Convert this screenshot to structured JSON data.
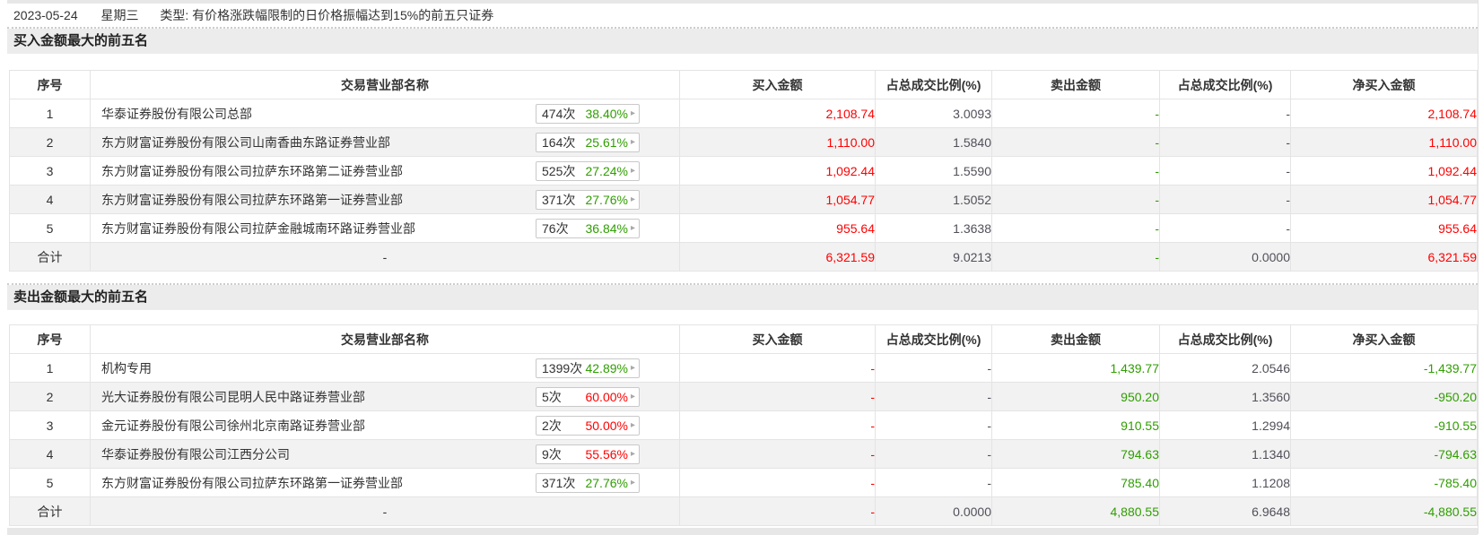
{
  "info_bar": {
    "date": "2023-05-24",
    "weekday": "星期三",
    "type_text": "类型: 有价格涨跌幅限制的日价格振幅达到15%的前五只证券"
  },
  "icons": {
    "chevron_right": "▸"
  },
  "colors": {
    "up_red": "#ff0000",
    "down_green": "#2f9e00",
    "ratio_text": "#50505a",
    "section_bar_bg": "#ececec",
    "zebra_row_bg": "#f2f2f2"
  },
  "columns": {
    "seq": "序号",
    "name": "交易营业部名称",
    "buy": "买入金额",
    "buy_ratio": "占总成交比例(%)",
    "sell": "卖出金额",
    "sell_ratio": "占总成交比例(%)",
    "net": "净买入金额"
  },
  "tables": [
    {
      "title": "买入金额最大的前五名",
      "net_color": "red",
      "rows": [
        {
          "seq": "1",
          "name": "华泰证券股份有限公司总部",
          "count": "474次",
          "percent": "38.40%",
          "percent_color": "green",
          "buy": "2,108.74",
          "ratio1": "3.0093",
          "sell": "-",
          "ratio2": "-",
          "net": "2,108.74"
        },
        {
          "seq": "2",
          "name": "东方财富证券股份有限公司山南香曲东路证券营业部",
          "count": "164次",
          "percent": "25.61%",
          "percent_color": "green",
          "buy": "1,110.00",
          "ratio1": "1.5840",
          "sell": "-",
          "ratio2": "-",
          "net": "1,110.00"
        },
        {
          "seq": "3",
          "name": "东方财富证券股份有限公司拉萨东环路第二证券营业部",
          "count": "525次",
          "percent": "27.24%",
          "percent_color": "green",
          "buy": "1,092.44",
          "ratio1": "1.5590",
          "sell": "-",
          "ratio2": "-",
          "net": "1,092.44"
        },
        {
          "seq": "4",
          "name": "东方财富证券股份有限公司拉萨东环路第一证券营业部",
          "count": "371次",
          "percent": "27.76%",
          "percent_color": "green",
          "buy": "1,054.77",
          "ratio1": "1.5052",
          "sell": "-",
          "ratio2": "-",
          "net": "1,054.77"
        },
        {
          "seq": "5",
          "name": "东方财富证券股份有限公司拉萨金融城南环路证券营业部",
          "count": "76次",
          "percent": "36.84%",
          "percent_color": "green",
          "buy": "955.64",
          "ratio1": "1.3638",
          "sell": "-",
          "ratio2": "-",
          "net": "955.64"
        }
      ],
      "total": {
        "seq": "合计",
        "name": "-",
        "buy": "6,321.59",
        "ratio1": "9.0213",
        "sell": "-",
        "ratio2": "0.0000",
        "net": "6,321.59"
      }
    },
    {
      "title": "卖出金额最大的前五名",
      "net_color": "green",
      "rows": [
        {
          "seq": "1",
          "name": "机构专用",
          "count": "1399次",
          "percent": "42.89%",
          "percent_color": "green",
          "buy": "-",
          "ratio1": "-",
          "sell": "1,439.77",
          "ratio2": "2.0546",
          "net": "-1,439.77"
        },
        {
          "seq": "2",
          "name": "光大证券股份有限公司昆明人民中路证券营业部",
          "count": "5次",
          "percent": "60.00%",
          "percent_color": "red",
          "buy": "-",
          "ratio1": "-",
          "sell": "950.20",
          "ratio2": "1.3560",
          "net": "-950.20"
        },
        {
          "seq": "3",
          "name": "金元证券股份有限公司徐州北京南路证券营业部",
          "count": "2次",
          "percent": "50.00%",
          "percent_color": "red",
          "buy": "-",
          "ratio1": "-",
          "sell": "910.55",
          "ratio2": "1.2994",
          "net": "-910.55"
        },
        {
          "seq": "4",
          "name": "华泰证券股份有限公司江西分公司",
          "count": "9次",
          "percent": "55.56%",
          "percent_color": "red",
          "buy": "-",
          "ratio1": "-",
          "sell": "794.63",
          "ratio2": "1.1340",
          "net": "-794.63"
        },
        {
          "seq": "5",
          "name": "东方财富证券股份有限公司拉萨东环路第一证券营业部",
          "count": "371次",
          "percent": "27.76%",
          "percent_color": "green",
          "buy": "-",
          "ratio1": "-",
          "sell": "785.40",
          "ratio2": "1.1208",
          "net": "-785.40"
        }
      ],
      "total": {
        "seq": "合计",
        "name": "-",
        "buy": "-",
        "ratio1": "0.0000",
        "sell": "4,880.55",
        "ratio2": "6.9648",
        "net": "-4,880.55"
      }
    }
  ]
}
